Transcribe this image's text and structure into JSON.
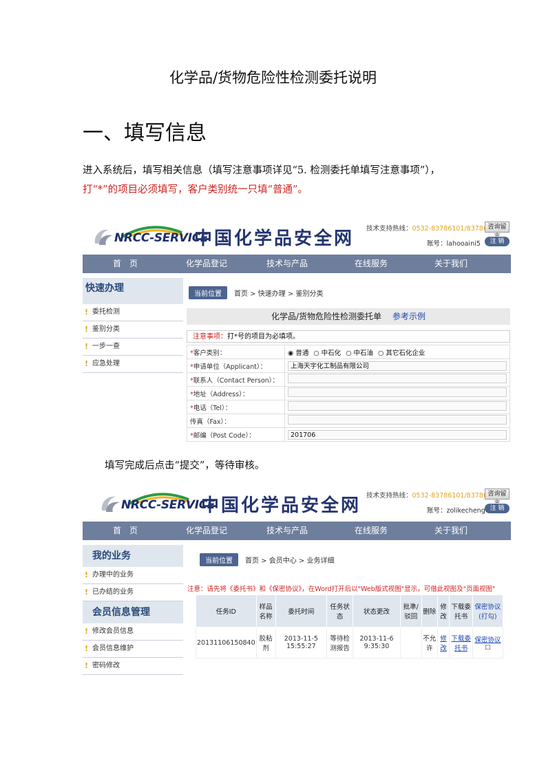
{
  "doc": {
    "title": "化学品/货物危险性检测委托说明",
    "heading": "一、填写信息",
    "para1": "进入系统后，填写相关信息（填写注意事项详见“5. 检测委托单填写注意事项”），",
    "para2": "打“*”的项目必须填写，客户类别统一只填“普通”。",
    "para3": "填写完成后点击“提交”，等待审核。"
  },
  "header": {
    "logo_text": "NRCC-SERVICE",
    "site_name": "中国化学品安全网",
    "hotline_label": "技术支持热线：",
    "hotline_number": "0532-83786101/83786270",
    "consult_label": "咨询留言",
    "logout_label": "注 销"
  },
  "nav": [
    "首　页",
    "化学品登记",
    "技术与产品",
    "在线服务",
    "关于我们"
  ],
  "shot1": {
    "user": "账号：lahooaini5",
    "sidebar_title": "快速办理",
    "sidebar_items": [
      "委托检测",
      "鉴别分类",
      "一步一查",
      "应急处理"
    ],
    "crumb_tag": "当前位置",
    "crumb": "首页 > 快速办理 > 鉴别分类",
    "form_title": "化学品/货物危险性检测委托单",
    "form_link": "参考示例",
    "notice_label": "注意事项：",
    "notice_text": "打*号的项目为必填项。",
    "fields": [
      {
        "label": "客户类别：",
        "required": true,
        "type": "radio",
        "options": [
          "普通",
          "中石化",
          "中石油",
          "其它石化企业"
        ],
        "selected": "普通"
      },
      {
        "label": "申请单位（Applicant）：",
        "required": true,
        "value": "上海天宇化工制品有限公司"
      },
      {
        "label": "联系人（Contact Person）：",
        "required": true,
        "value": ""
      },
      {
        "label": "地址（Address）：",
        "required": true,
        "value": ""
      },
      {
        "label": "电话（Tel）：",
        "required": true,
        "value": ""
      },
      {
        "label": "传真（Fax）：",
        "required": false,
        "value": ""
      },
      {
        "label": "邮编（Post Code）：",
        "required": true,
        "value": "201706"
      }
    ]
  },
  "shot2": {
    "user": "账号：zolikecheng",
    "side_heads": [
      "我的业务",
      "会员信息管理"
    ],
    "side_items_1": [
      "办理中的业务",
      "已办结的业务"
    ],
    "side_items_2": [
      "修改会员信息",
      "会员信息维护",
      "密码修改"
    ],
    "crumb_tag": "当前位置",
    "crumb": "首页 > 会员中心 > 业务详细",
    "notice": "注意：请先将《委托书》和《保密协议》，在Word打开后以\"Web版式视图\"显示，可借此视图及\"页面视图\"",
    "columns": [
      "任务ID",
      "样品名称",
      "委托时间",
      "任务状态",
      "状态更改",
      "批準/驳回",
      "删除",
      "修改",
      "下载委托书",
      "保密协议(打勾)"
    ],
    "rows": [
      [
        "20131106150840",
        "胶粘剂",
        "2013-11-5 15:55:27",
        "等待检测报告",
        "2013-11-6 9:35:30",
        "",
        "不允许",
        "修改",
        "下载委托书",
        "保密协议"
      ]
    ]
  }
}
